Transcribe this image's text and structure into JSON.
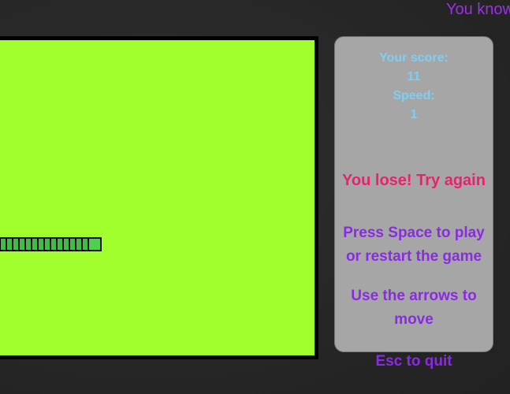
{
  "marquee": "You know",
  "panel": {
    "score_label": "Your score:",
    "score": "11",
    "speed_label": "Speed:",
    "speed": "1",
    "lose_message": "You lose! Try again",
    "instructions_1": "Press Space to play or restart the game",
    "instructions_2": "Use the arrows to move"
  },
  "footer": {
    "quit": "Esc to quit"
  },
  "colors": {
    "board": "#a2ff2e",
    "snake": "#3fbf3f",
    "panel": "#a6a6a6",
    "score_text": "#7ecff3",
    "lose_text": "#e8226e",
    "help_text": "#8a2be2"
  }
}
